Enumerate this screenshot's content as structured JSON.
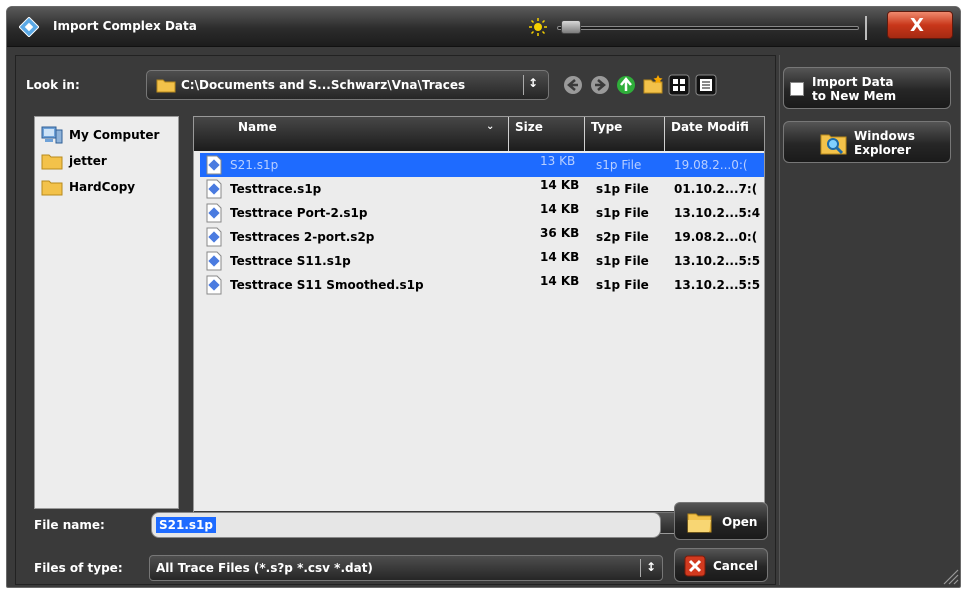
{
  "window": {
    "title": "Import Complex Data",
    "close_label": "X"
  },
  "look_in": {
    "label": "Look in:",
    "value": "C:\\Documents and S...Schwarz\\Vna\\Traces",
    "spin_glyph": "↕"
  },
  "nav": [
    "back-icon",
    "forward-icon",
    "up-folder-icon",
    "new-folder-icon",
    "list-view-icon",
    "details-view-icon"
  ],
  "places": [
    {
      "label": "My Computer",
      "icon": "computer-icon"
    },
    {
      "label": "jetter",
      "icon": "folder-icon"
    },
    {
      "label": "HardCopy",
      "icon": "folder-icon"
    }
  ],
  "file_list": {
    "columns": [
      "Name",
      "Size",
      "Type",
      "Date Modifi"
    ],
    "rows": [
      {
        "name": "S21.s1p",
        "size": "13 KB",
        "type": "s1p File",
        "date": "19.08.2...0:(",
        "selected": true
      },
      {
        "name": "Testtrace.s1p",
        "size": "14 KB",
        "type": "s1p File",
        "date": "01.10.2...7:(",
        "selected": false
      },
      {
        "name": "Testtrace Port-2.s1p",
        "size": "14 KB",
        "type": "s1p File",
        "date": "13.10.2...5:4",
        "selected": false
      },
      {
        "name": "Testtraces 2-port.s2p",
        "size": "36 KB",
        "type": "s2p File",
        "date": "19.08.2...0:(",
        "selected": false
      },
      {
        "name": "Testtrace S11.s1p",
        "size": "14 KB",
        "type": "s1p File",
        "date": "13.10.2...5:5",
        "selected": false
      },
      {
        "name": "Testtrace S11 Smoothed.s1p",
        "size": "14 KB",
        "type": "s1p File",
        "date": "13.10.2...5:5",
        "selected": false
      }
    ]
  },
  "file_name": {
    "label": "File name:",
    "value": "S21.s1p"
  },
  "files_of_type": {
    "label": "Files of type:",
    "value": "All Trace Files (*.s?p *.csv *.dat)"
  },
  "buttons": {
    "open": "Open",
    "cancel": "Cancel"
  },
  "side": {
    "import_new_mem_line1": "Import Data",
    "import_new_mem_line2": "to New Mem",
    "windows_explorer_line1": "Windows",
    "windows_explorer_line2": "Explorer"
  },
  "colors": {
    "selection": "#1e6bff",
    "panel": "#3a3a3a",
    "close": "#c8371a"
  }
}
